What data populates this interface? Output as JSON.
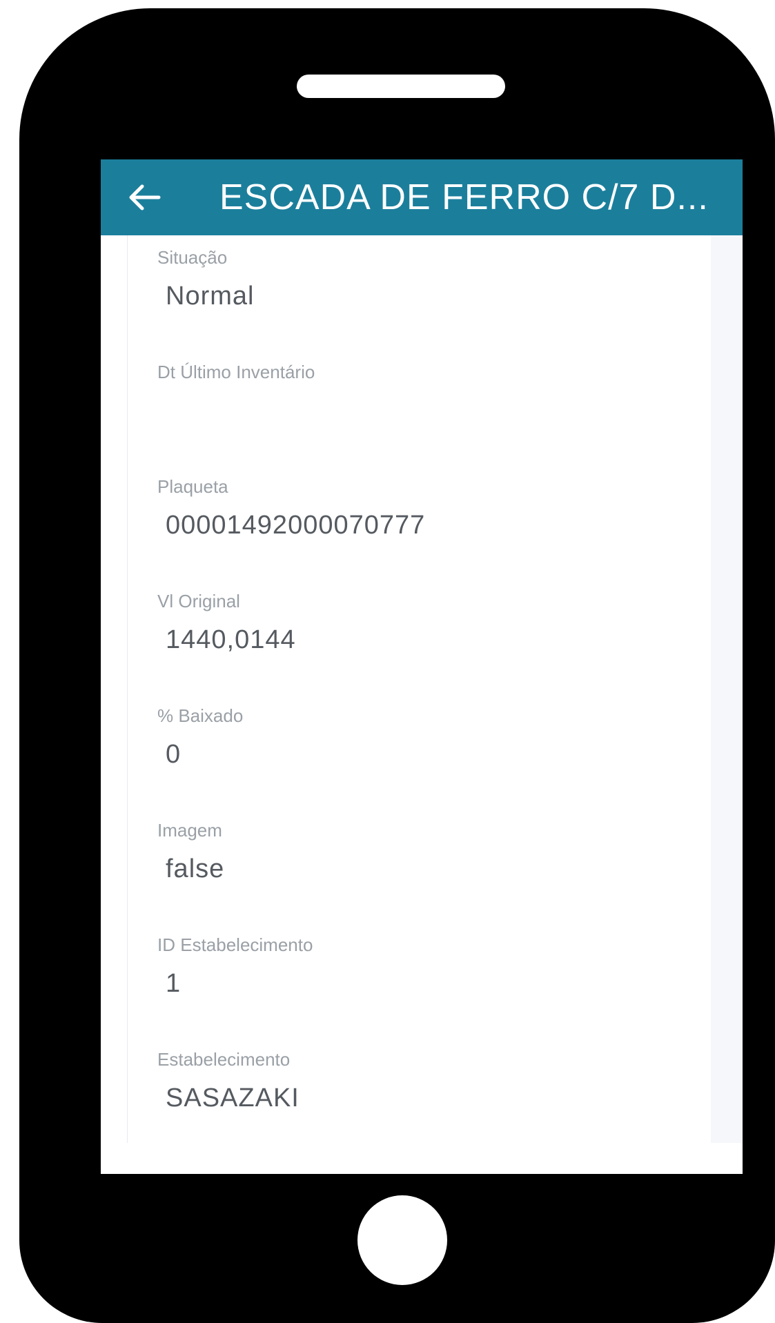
{
  "app_bar": {
    "back_icon": "arrow-left-icon",
    "title": "ESCADA DE FERRO C/7 D..."
  },
  "fields": [
    {
      "label": "Situação",
      "value": "Normal"
    },
    {
      "label": "Dt Último Inventário",
      "value": ""
    },
    {
      "label": "Plaqueta",
      "value": "00001492000070777"
    },
    {
      "label": "Vl Original",
      "value": "1440,0144"
    },
    {
      "label": "% Baixado",
      "value": "0"
    },
    {
      "label": "Imagem",
      "value": "false"
    },
    {
      "label": "ID Estabelecimento",
      "value": "1"
    },
    {
      "label": "Estabelecimento",
      "value": "SASAZAKI"
    }
  ],
  "colors": {
    "app_bar": "#1b7f9c",
    "label_text": "#9aa0a6",
    "value_text": "#555a60",
    "device_frame": "#000000"
  }
}
